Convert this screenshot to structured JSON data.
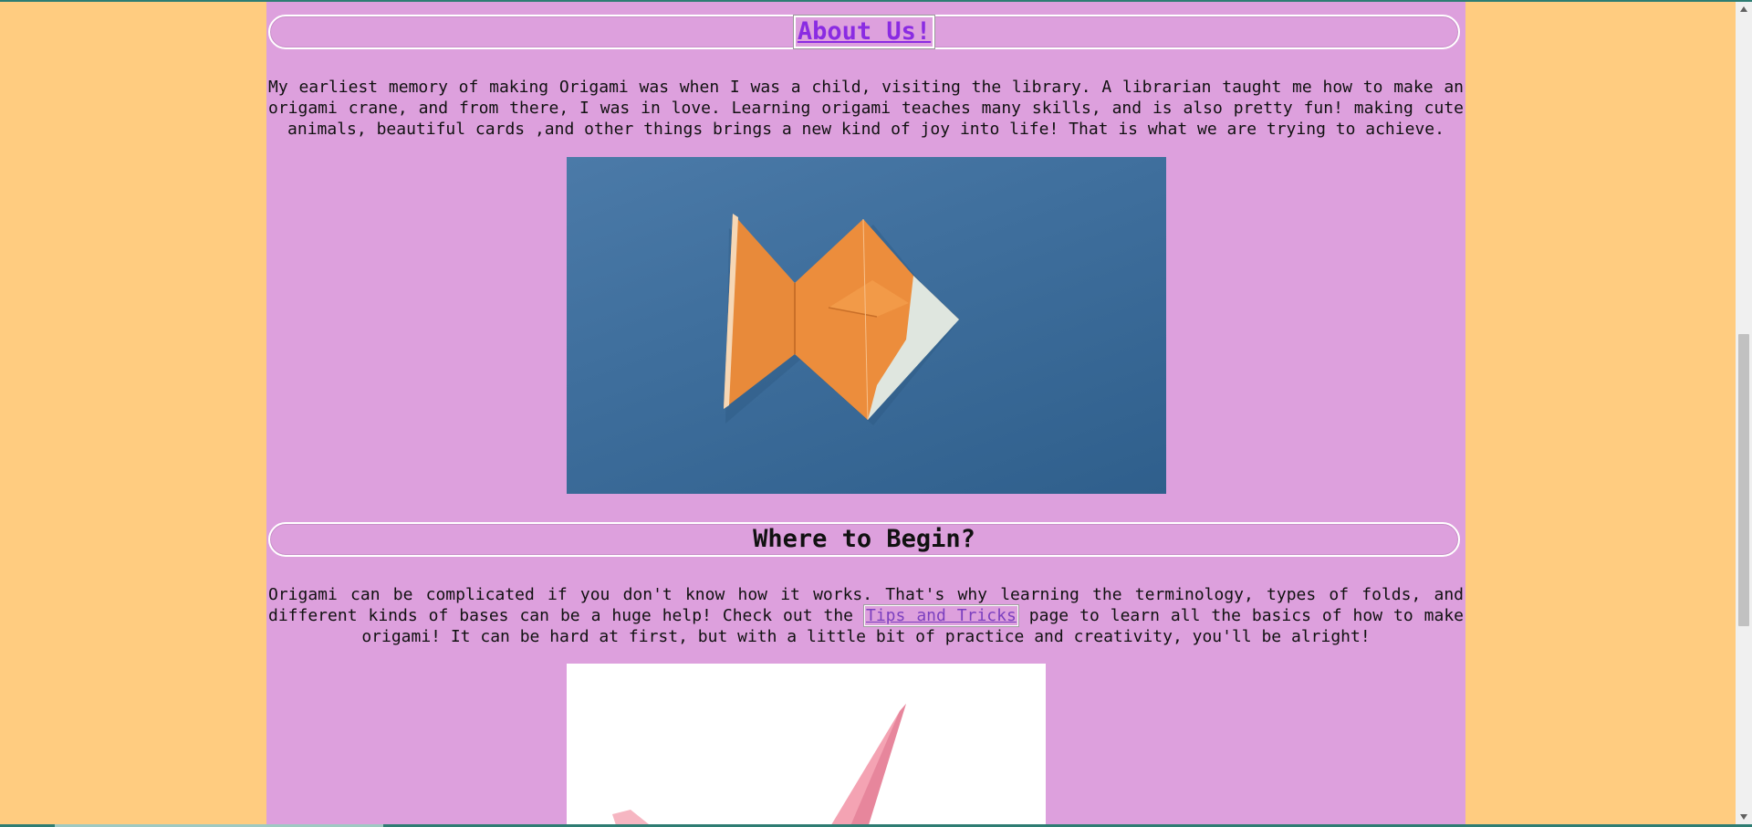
{
  "colors": {
    "page_background": "#ffcc80",
    "content_background": "#dda0dd",
    "link_color": "#8a2be2",
    "fish_photo_background": "#3f6f9d"
  },
  "sections": [
    {
      "title": "About Us!",
      "paragraph": "My earliest memory of making Origami was when I was a child, visiting the library. A librarian taught me how to make an origami crane, and from there, I was in love. Learning origami teaches many skills, and is also pretty fun! making cute animals, beautiful cards ,and other things brings a new kind of joy into life! That is what we are trying to achieve."
    },
    {
      "title": "Where to Begin?",
      "paragraph_before_link": "Origami can be complicated if you don't know how it works. That's why learning the terminology, types of folds, and different kinds of bases can be a huge help! Check out the ",
      "link_text": "Tips and Tricks",
      "paragraph_after_link": " page to learn all the basics of how to make origami! It can be hard at first, but with a little bit of practice and creativity, you'll be alright!"
    }
  ],
  "scrollbar": {
    "up_icon": "triangle-up",
    "down_icon": "triangle-down"
  }
}
